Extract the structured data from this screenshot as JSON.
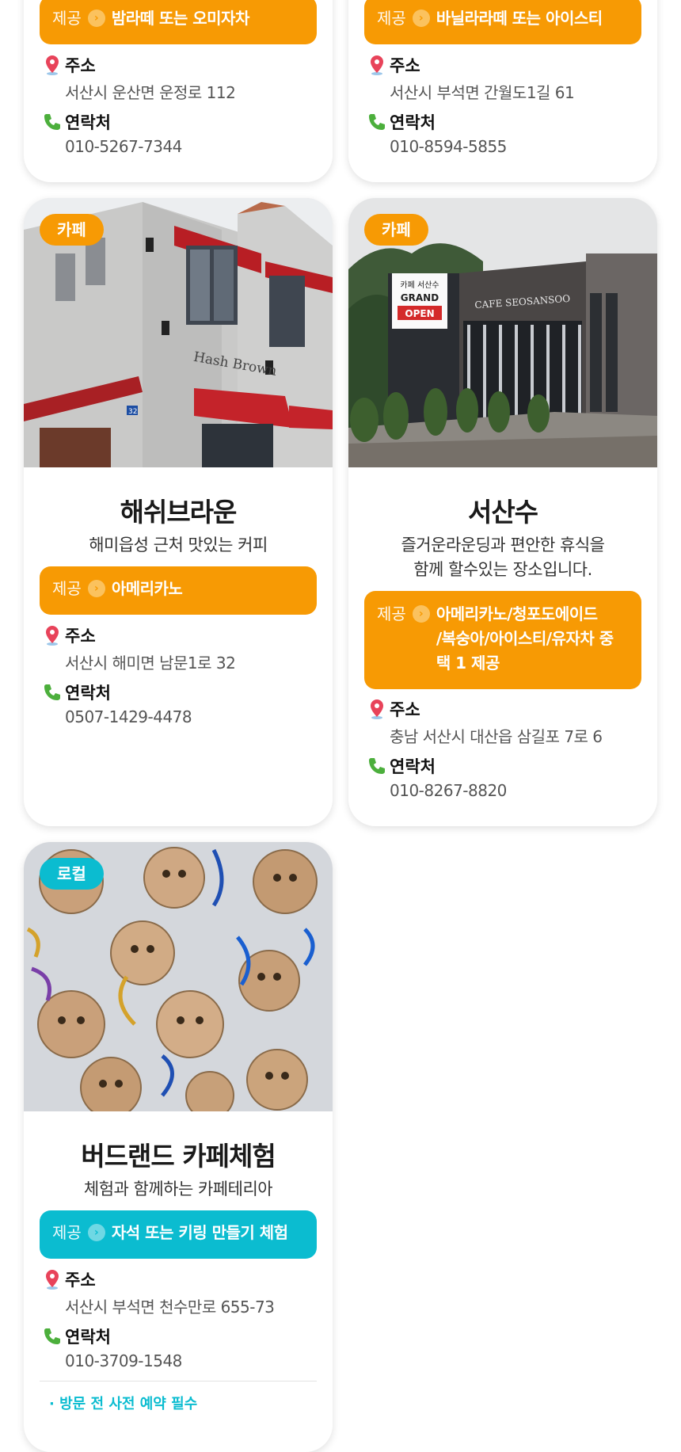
{
  "labels": {
    "offer": "제공",
    "address": "주소",
    "contact": "연락처"
  },
  "cards": [
    {
      "tag": "",
      "title": "",
      "desc": "",
      "offer": "밤라떼 또는 오미자차",
      "address": "서산시 운산면 운정로 112",
      "contact": "010-5267-7344"
    },
    {
      "tag": "",
      "title": "",
      "desc": "",
      "offer": "바닐라라떼 또는 아이스티",
      "address": "서산시 부석면 간월도1길 61",
      "contact": "010-8594-5855"
    },
    {
      "tag": "카페",
      "title": "해쉬브라운",
      "desc": "해미읍성 근처 맛있는 커피",
      "offer": "아메리카노",
      "address": "서산시 해미면 남문1로 32",
      "contact": "0507-1429-4478",
      "photo_sign": "Hash Brown",
      "photo_number": "32"
    },
    {
      "tag": "카페",
      "title": "서산수",
      "desc_lines": [
        "즐거운라운딩과 편안한 휴식을",
        "함께 할수있는 장소입니다."
      ],
      "offer_lines": [
        "아메리카노/청포도에이드",
        "/복숭아/아이스티/유자차 중",
        "택 1 제공"
      ],
      "address": "충남 서산시 대산읍 삼길포 7로 6",
      "contact": "010-8267-8820",
      "photo_banner": [
        "카페 서산수",
        "GRAND",
        "OPEN"
      ],
      "photo_sign": "CAFE SEOSANSOO"
    },
    {
      "tag": "로컬",
      "title": "버드랜드 카페체험",
      "desc": "체험과 함께하는 카페테리아",
      "offer": "자석 또는 키링 만들기 체험",
      "address": "서산시 부석면 천수만로 655-73",
      "contact": "010-3709-1548",
      "note": "· 방문 전 사전 예약 필수"
    }
  ],
  "colors": {
    "orange": "#f79a04",
    "teal": "#0bbcd0",
    "pin": "#e8435a",
    "phone": "#4caf3c"
  }
}
